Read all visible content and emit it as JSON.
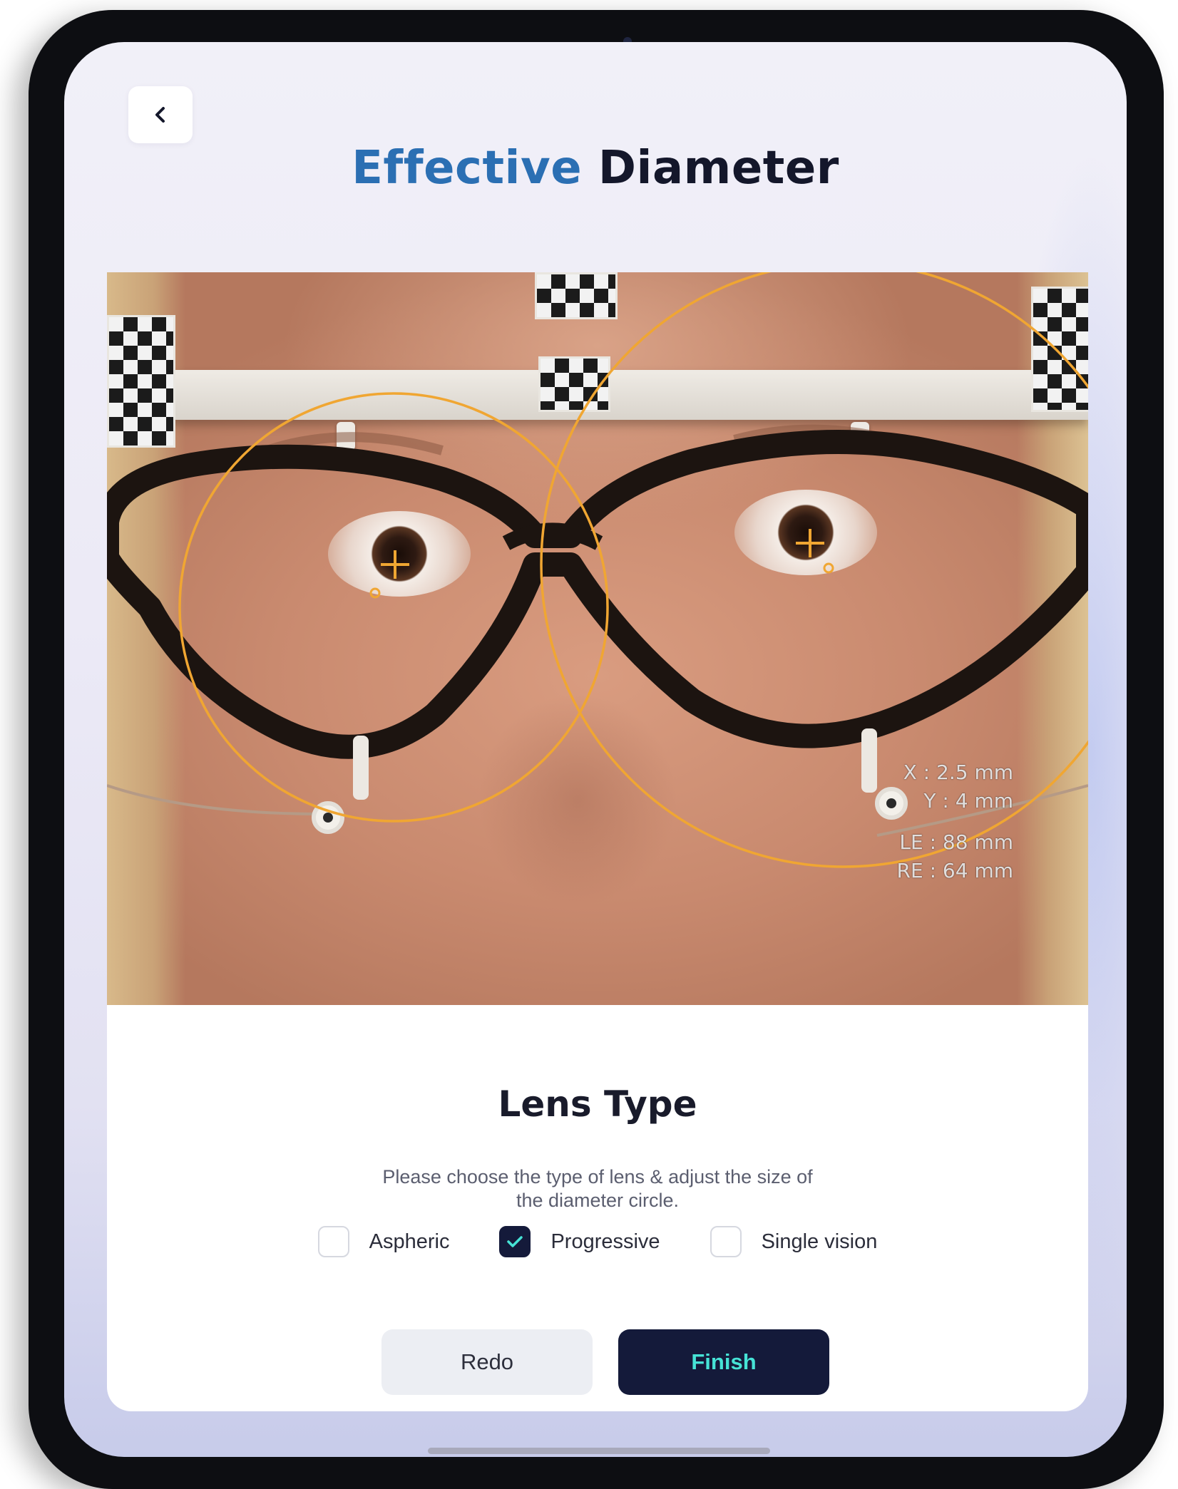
{
  "header": {
    "back_icon": "chevron-left-icon",
    "title_accent": "Effective",
    "title_main": "Diameter"
  },
  "measurements": {
    "x": "X : 2.5 mm",
    "y": "Y : 4 mm",
    "le": "LE : 88 mm",
    "re": "RE : 64 mm"
  },
  "lens_type": {
    "title": "Lens Type",
    "description_line1": "Please choose the type of lens & adjust  the size of",
    "description_line2": "the diameter circle.",
    "options": [
      {
        "label": "Aspheric",
        "checked": false
      },
      {
        "label": "Progressive",
        "checked": true
      },
      {
        "label": "Single vision",
        "checked": false
      }
    ]
  },
  "actions": {
    "redo_label": "Redo",
    "finish_label": "Finish"
  },
  "colors": {
    "title_accent": "#2b6fb3",
    "title_main": "#14172b",
    "overlay_circle": "#f0a632",
    "primary_button": "#141a3a",
    "primary_button_text": "#46e3d6"
  }
}
